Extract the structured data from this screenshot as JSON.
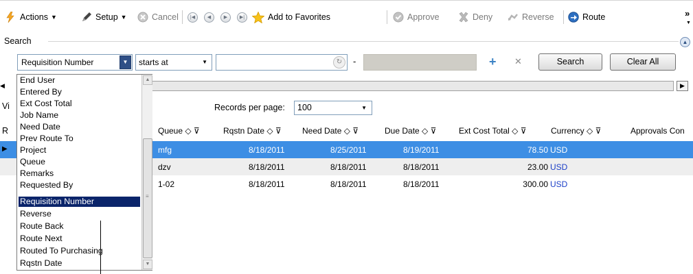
{
  "toolbar": {
    "actions": "Actions",
    "setup": "Setup",
    "cancel": "Cancel",
    "add_favorites": "Add to Favorites",
    "approve": "Approve",
    "deny": "Deny",
    "reverse": "Reverse",
    "route": "Route",
    "overflow": "»"
  },
  "search": {
    "title": "Search",
    "field": "Requisition Number",
    "operator": "starts at",
    "value": "",
    "dash": "-",
    "search_button": "Search",
    "clear_button": "Clear All"
  },
  "view_label_fragment": "Vi",
  "records_per_page": {
    "label": "Records per page:",
    "value": "100"
  },
  "grid": {
    "row_header_fragment": "R",
    "columns": [
      "Queue",
      "Rqstn Date",
      "Need Date",
      "Due Date",
      "Ext Cost Total",
      "Currency",
      "Approvals Con"
    ],
    "rows": [
      {
        "queue": "mfg",
        "rqstn_date": "8/18/2011",
        "need_date": "8/25/2011",
        "due_date": "8/19/2011",
        "ext_cost": "78.50",
        "currency": "USD"
      },
      {
        "queue": "dzv",
        "rqstn_date": "8/18/2011",
        "need_date": "8/18/2011",
        "due_date": "8/18/2011",
        "ext_cost": "23.00",
        "currency": "USD"
      },
      {
        "queue": "1-02",
        "rqstn_date": "8/18/2011",
        "need_date": "8/18/2011",
        "due_date": "8/18/2011",
        "ext_cost": "300.00",
        "currency": "USD"
      }
    ]
  },
  "dropdown": {
    "items": [
      "End User",
      "Entered By",
      "Ext Cost Total",
      "Job Name",
      "Need Date",
      "Prev Route To",
      "Project",
      "Queue",
      "Remarks",
      "Requested By",
      "Requisition Number",
      "Reverse",
      "Route Back",
      "Route Next",
      "Routed To Purchasing",
      "Rqstn Date"
    ],
    "selected": "Requisition Number"
  },
  "colors": {
    "selected_row": "#3d8ee4",
    "dropdown_highlight": "#0a246a",
    "currency_link": "#1c3fc7"
  }
}
